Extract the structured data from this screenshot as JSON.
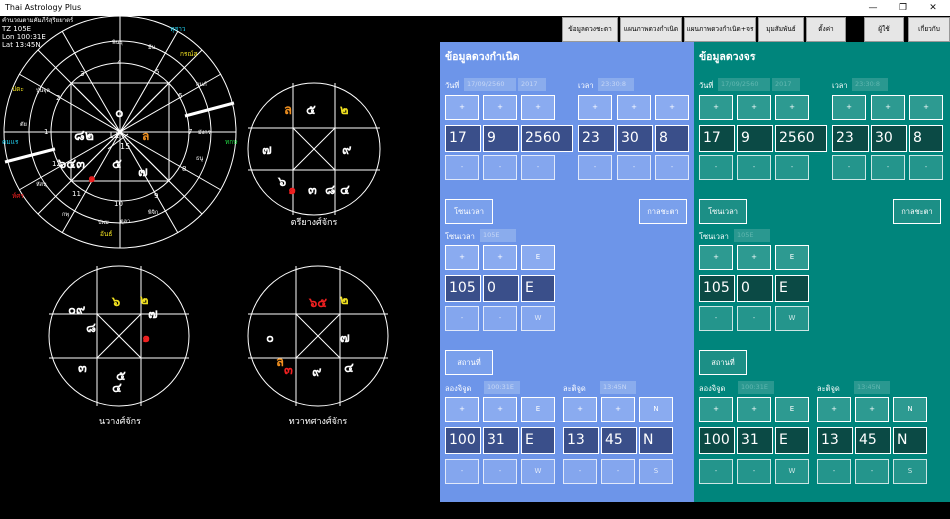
{
  "window": {
    "title": "Thai Astrology Plus",
    "min": "—",
    "restore": "❐",
    "close": "✕"
  },
  "wheel_info": {
    "line1": "คำนวณตามคัมภีร์สุริยยาตร์",
    "tz": "TZ 105E",
    "lon": "Lon 100:31E",
    "lat": "Lat 13:45N"
  },
  "toolbar": [
    "ข้อมูลดวงชะตา",
    "แผนภาพดวงกำเนิด",
    "แผนภาพดวงกำเนิด+จร",
    "มุมสัมพันธ์",
    "ตั้งค่า",
    "ผู้ใช้",
    "เกี่ยวกับ"
  ],
  "wheel": {
    "center_top": "๐",
    "center_mid": "11",
    "center_bot": "15",
    "left_num": "๘๒",
    "right_mark": "ล",
    "lower_left": "๖๔๓",
    "lower_red": "๑",
    "lower_mid": "๕",
    "lower_right": "๗",
    "house_numbers": [
      "4",
      "3",
      "2",
      "1",
      "12",
      "11",
      "10",
      "9",
      "8",
      "7",
      "6",
      "5"
    ],
    "outer_signs": [
      "พินธุ",
      "ปุ่นจุล",
      "ตัย",
      "หัสนุ",
      "กพุ",
      "ปพม",
      "ตุลา",
      "พิจิก",
      "ธนู",
      "มังกร",
      "กุมภ์",
      "มีน"
    ],
    "yellow_labels": [
      "ปตะ",
      "กรณ์ส"
    ],
    "cyan_labels": [
      "ทุสาว",
      "คมแร",
      "ทกษ"
    ],
    "red_labels": [
      "ห์ศร",
      "อันธ์"
    ]
  },
  "trianga": {
    "title": "ตรียางศ์จักร",
    "cells": [
      "ล",
      "๕",
      "๒",
      "๗",
      "๙",
      "๖",
      "๑",
      "๔",
      "๓",
      "๘"
    ]
  },
  "navang": {
    "title": "นวางศ์จักร",
    "cells": [
      "๐๙",
      "๖",
      "๒",
      "๗",
      "๑",
      "๓",
      "๕",
      "๘",
      "๔"
    ]
  },
  "dwadas": {
    "title": "ทวาทศางศ์จักร",
    "cells": [
      "๖๕",
      "๒",
      "๐",
      "๗",
      "ล",
      "๓",
      "๙",
      "๔"
    ]
  },
  "birth": {
    "title": "ข้อมูลดวงกำเนิด",
    "date_label": "วันที่",
    "date_value": "17/09/2560",
    "year_ad": "2017",
    "time_label": "เวลา",
    "time_value": "23:30:8",
    "date_vals": [
      "17",
      "9",
      "2560"
    ],
    "time_vals": [
      "23",
      "30",
      "8"
    ],
    "plus": "+",
    "minus": "-",
    "tz_btn": "โซนเวลา",
    "kala_btn": "กาลชะตา",
    "tz_label": "โซนเวลา",
    "tz_value": "105E",
    "tz_vals": [
      "105",
      "0",
      "E"
    ],
    "tz_e": "E",
    "tz_w": "W",
    "place_btn": "สถานที่",
    "lon_label": "ลองจิจูด",
    "lon_value": "100:31E",
    "lat_label": "ละติจูด",
    "lat_value": "13:45N",
    "lon_vals": [
      "100",
      "31",
      "E"
    ],
    "lat_vals": [
      "13",
      "45",
      "N"
    ],
    "n": "N",
    "s": "S"
  },
  "transit": {
    "title": "ข้อมูลดวงจร",
    "date_label": "วันที่",
    "date_value": "17/09/2560",
    "year_ad": "2017",
    "time_label": "เวลา",
    "time_value": "23:30:8",
    "date_vals": [
      "17",
      "9",
      "2560"
    ],
    "time_vals": [
      "23",
      "30",
      "8"
    ],
    "tz_btn": "โซนเวลา",
    "kala_btn": "กาลชะตา",
    "tz_label": "โซนเวลา",
    "tz_value": "105E",
    "tz_vals": [
      "105",
      "0",
      "E"
    ],
    "place_btn": "สถานที่",
    "lon_label": "ลองจิจูด",
    "lon_value": "100:31E",
    "lat_label": "ละติจูด",
    "lat_value": "13:45N",
    "lon_vals": [
      "100",
      "31",
      "E"
    ],
    "lat_vals": [
      "13",
      "45",
      "N"
    ]
  },
  "colors": {
    "birth_bg": "#6d95e9",
    "transit_bg": "#00857c",
    "yellow": "#f0e020",
    "orange": "#f09020",
    "red": "#f02020",
    "cyan": "#20d0f0",
    "green": "#20d040"
  }
}
